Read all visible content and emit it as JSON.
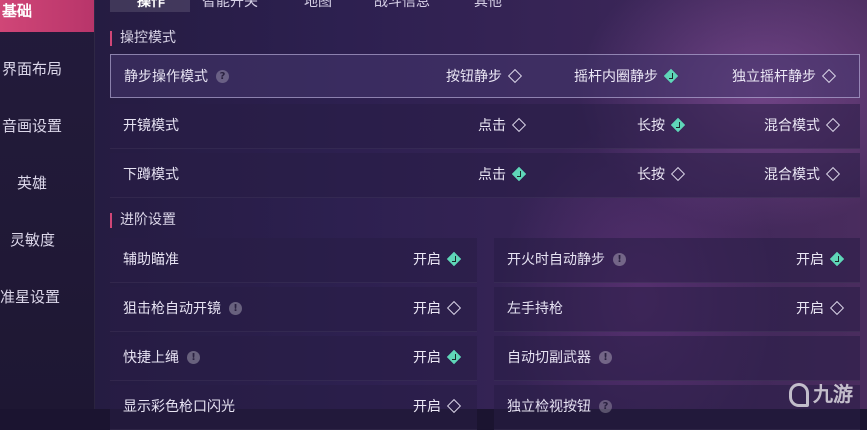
{
  "sidebar": {
    "items": [
      {
        "label": "基础",
        "active": true
      },
      {
        "label": "界面布局"
      },
      {
        "label": "音画设置"
      },
      {
        "label": "英雄"
      },
      {
        "label": "灵敏度"
      },
      {
        "label": "准星设置"
      }
    ]
  },
  "tabs": [
    {
      "label": "操作",
      "active": true
    },
    {
      "label": "智能开关"
    },
    {
      "label": "地图"
    },
    {
      "label": "战斗信息"
    },
    {
      "label": "其他"
    }
  ],
  "section_control": {
    "title": "操控模式",
    "rows": [
      {
        "label": "静步操作模式",
        "help": "?",
        "options": [
          {
            "label": "按钮静步",
            "checked": false
          },
          {
            "label": "摇杆内圈静步",
            "checked": true
          },
          {
            "label": "独立摇杆静步",
            "checked": false
          }
        ]
      },
      {
        "label": "开镜模式",
        "options": [
          {
            "label": "点击",
            "checked": false
          },
          {
            "label": "长按",
            "checked": true
          },
          {
            "label": "混合模式",
            "checked": false
          }
        ]
      },
      {
        "label": "下蹲模式",
        "options": [
          {
            "label": "点击",
            "checked": true
          },
          {
            "label": "长按",
            "checked": false
          },
          {
            "label": "混合模式",
            "checked": false
          }
        ]
      }
    ]
  },
  "section_advanced": {
    "title": "进阶设置",
    "left": [
      {
        "label": "辅助瞄准",
        "info": "",
        "value": "开启",
        "checked": true
      },
      {
        "label": "狙击枪自动开镜",
        "info": "!",
        "value": "开启",
        "checked": false
      },
      {
        "label": "快捷上绳",
        "info": "!",
        "value": "开启",
        "checked": true
      },
      {
        "label": "显示彩色枪口闪光",
        "info": "",
        "value": "开启",
        "checked": false
      }
    ],
    "right": [
      {
        "label": "开火时自动静步",
        "info": "!",
        "value": "开启",
        "checked": true
      },
      {
        "label": "左手持枪",
        "info": "",
        "value": "开启",
        "checked": false
      },
      {
        "label": "自动切副武器",
        "info": "!",
        "value": "",
        "checked": false
      },
      {
        "label": "独立检视按钮",
        "info": "?",
        "value": "",
        "checked": false
      }
    ]
  },
  "watermark": {
    "text": "九游"
  },
  "colors": {
    "accent": "#d04677",
    "check": "#5fd6b8"
  }
}
